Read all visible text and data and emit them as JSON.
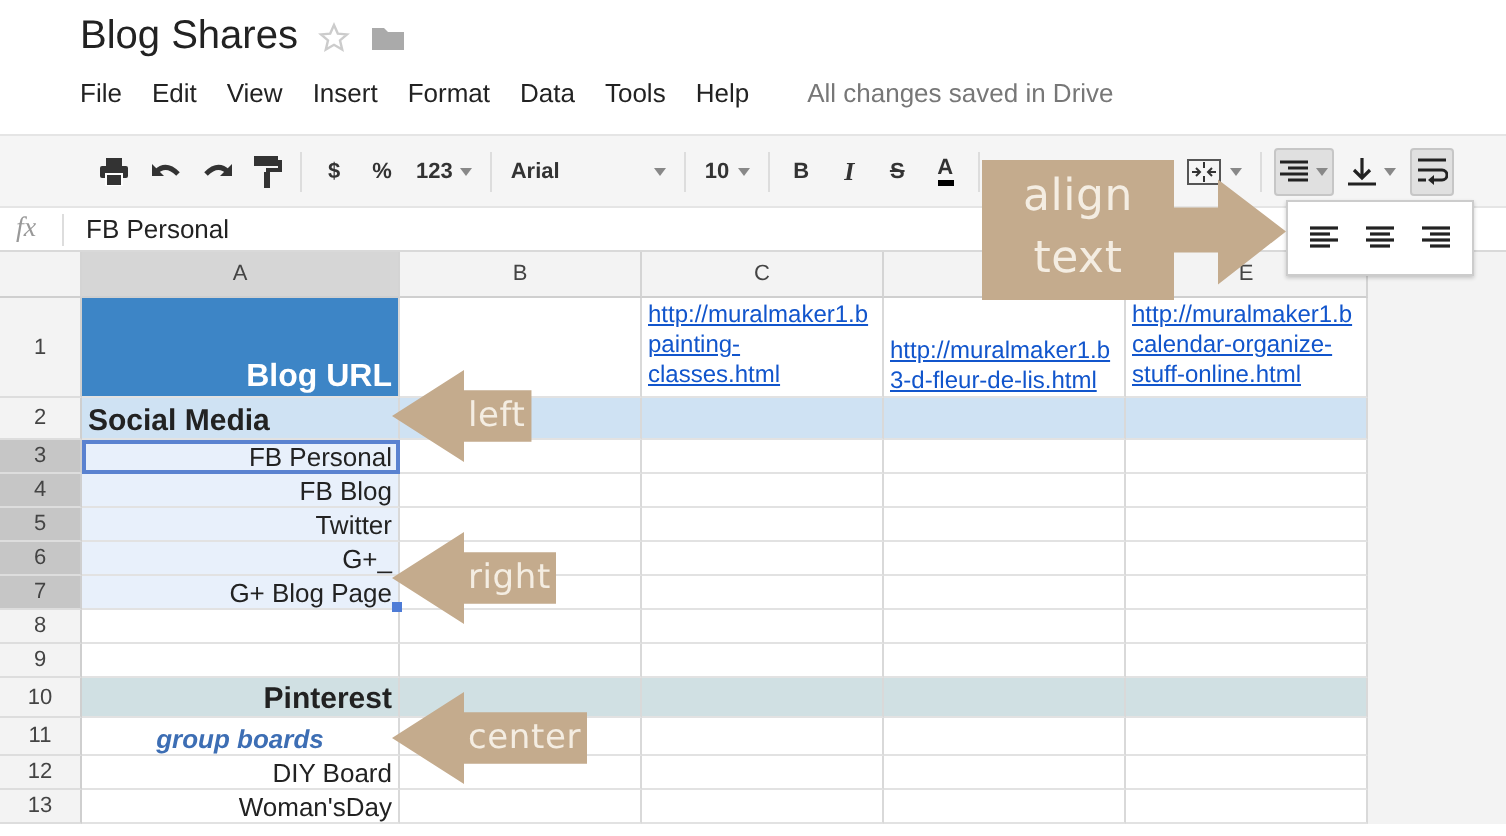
{
  "document": {
    "title": "Blog Shares",
    "starred": false
  },
  "menu": [
    "File",
    "Edit",
    "View",
    "Insert",
    "Format",
    "Data",
    "Tools",
    "Help"
  ],
  "save_status": "All changes saved in Drive",
  "toolbar": {
    "groups": [
      [
        {
          "kind": "print",
          "pressed": false
        },
        {
          "kind": "undo",
          "pressed": false
        },
        {
          "kind": "redo",
          "pressed": false
        },
        {
          "kind": "paint-format",
          "pressed": false
        }
      ],
      [
        {
          "kind": "text",
          "label": "$",
          "pressed": false
        },
        {
          "kind": "text",
          "label": "%",
          "pressed": false
        },
        {
          "kind": "dropdown",
          "label": "123",
          "pressed": false
        }
      ],
      [
        {
          "kind": "font",
          "label": "Arial",
          "pressed": false
        }
      ],
      [
        {
          "kind": "dropdown",
          "label": "10",
          "pressed": false
        }
      ],
      [
        {
          "kind": "bold",
          "label": "B",
          "pressed": false
        },
        {
          "kind": "italic",
          "label": "I",
          "pressed": false
        },
        {
          "kind": "strike",
          "label": "S",
          "pressed": false
        },
        {
          "kind": "color",
          "label": "A",
          "pressed": false
        }
      ],
      [
        {
          "kind": "merge",
          "pressed": false
        }
      ],
      [
        {
          "kind": "align",
          "pressed": true
        },
        {
          "kind": "valign",
          "pressed": false
        },
        {
          "kind": "wrap",
          "pressed": true
        }
      ]
    ]
  },
  "formula_bar": {
    "label": "fx",
    "value": "FB Personal"
  },
  "align_menu": {
    "open": true,
    "options": [
      {
        "kind": "left"
      },
      {
        "kind": "center"
      },
      {
        "kind": "right"
      }
    ]
  },
  "columns": [
    {
      "label": "A",
      "selected": true
    },
    {
      "label": "B",
      "selected": false
    },
    {
      "label": "C",
      "selected": false
    },
    {
      "selected": false
    },
    {
      "label": "E",
      "selected": false
    }
  ],
  "rows": [
    {
      "number": "1",
      "selected": false,
      "cells": {
        "A": {
          "kind": "title",
          "text": "Blog URL"
        },
        "C": {
          "kind": "link",
          "lines": [
            "http://muralmaker1.b",
            "painting-",
            "classes.html"
          ]
        },
        "D": {
          "kind": "link",
          "lines": [
            "http://muralmaker1.b",
            "3-d-fleur-de-lis.html"
          ]
        },
        "E": {
          "kind": "link",
          "lines": [
            "http://muralmaker1.b",
            "calendar-organize-",
            "stuff-online.html"
          ]
        }
      }
    },
    {
      "number": "2",
      "selected": false,
      "color": "#cfe2f3",
      "cells": {
        "A": {
          "kind": "section",
          "text": "Social Media"
        }
      }
    },
    {
      "number": "3",
      "selected": true,
      "cells": {
        "A": {
          "kind": "item",
          "text": "FB Personal",
          "active": true
        }
      }
    },
    {
      "number": "4",
      "selected": true,
      "cells": {
        "A": {
          "kind": "item",
          "text": "FB Blog",
          "active": false
        }
      }
    },
    {
      "number": "5",
      "selected": true,
      "cells": {
        "A": {
          "kind": "item",
          "text": "Twitter",
          "active": false
        }
      }
    },
    {
      "number": "6",
      "selected": true,
      "cells": {
        "A": {
          "kind": "item",
          "text": "G+_",
          "active": false
        }
      }
    },
    {
      "number": "7",
      "selected": true,
      "cells": {
        "A": {
          "kind": "item",
          "text": "G+ Blog Page",
          "active": false
        }
      }
    },
    {
      "number": "8",
      "selected": false,
      "cells": {}
    },
    {
      "number": "9",
      "selected": false,
      "cells": {}
    },
    {
      "number": "10",
      "selected": false,
      "color": "#d0e0e3",
      "cells": {
        "A": {
          "kind": "category",
          "text": "Pinterest"
        }
      }
    },
    {
      "number": "11",
      "selected": false,
      "cells": {
        "A": {
          "kind": "group-label",
          "text": "group boards"
        }
      }
    },
    {
      "number": "12",
      "selected": false,
      "cells": {
        "A": {
          "kind": "item",
          "text": "DIY Board",
          "active": false
        }
      }
    },
    {
      "number": "13",
      "selected": false,
      "cells": {
        "A": {
          "kind": "item",
          "text": "Woman'sDay",
          "active": false
        }
      }
    }
  ],
  "callouts": [
    {
      "kind": "box-arrow",
      "label": "align text"
    },
    {
      "kind": "arrow",
      "label": "left"
    },
    {
      "kind": "arrow",
      "label": "right"
    },
    {
      "kind": "arrow",
      "label": "center"
    }
  ]
}
